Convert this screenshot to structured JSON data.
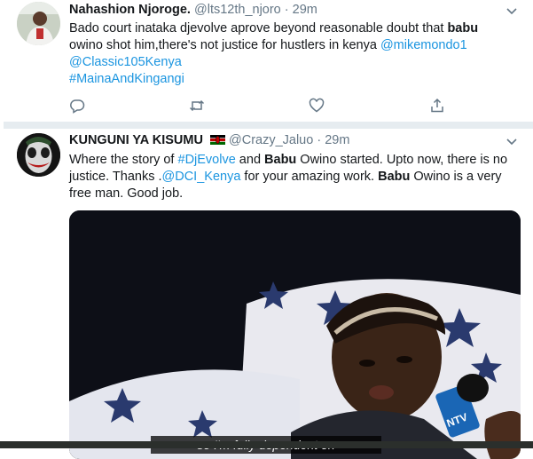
{
  "tweets": [
    {
      "display_name": "Nahashion Njoroge.",
      "handle": "@lts12th_njoro",
      "separator": "·",
      "time": "29m",
      "line1": {
        "text": "Bado court inataka  djevolve aprove beyond reasonable doubt that ",
        "bold": "babu"
      },
      "line2": {
        "text": " owino shot him,there's not justice for hustlers in kenya ",
        "link": "@mikemondo1"
      },
      "line3": "@Classic105Kenya",
      "line4": "#MainaAndKingangi",
      "actions": [
        "reply-icon",
        "retweet-icon",
        "like-icon",
        "share-icon"
      ]
    },
    {
      "display_name": "KUNGUNI YA KISUMU",
      "handle": "@Crazy_Jaluo",
      "separator": "·",
      "time": "29m",
      "flag_icon": "kenya-flag-icon",
      "text_parts": [
        "Where the story of ",
        "#DjEvolve",
        " and ",
        "Babu",
        " Owino started. Upto now, there is no justice. Thanks .",
        "@DCI_Kenya",
        " for your amazing work. ",
        "Babu",
        " Owino is a very free man. Good job."
      ],
      "video": {
        "caption": "so I'm fully dependent on",
        "mic_label": "NTV"
      }
    }
  ],
  "colors": {
    "link": "#1b95e0",
    "muted": "#657786",
    "divider": "#e6ecf0"
  }
}
